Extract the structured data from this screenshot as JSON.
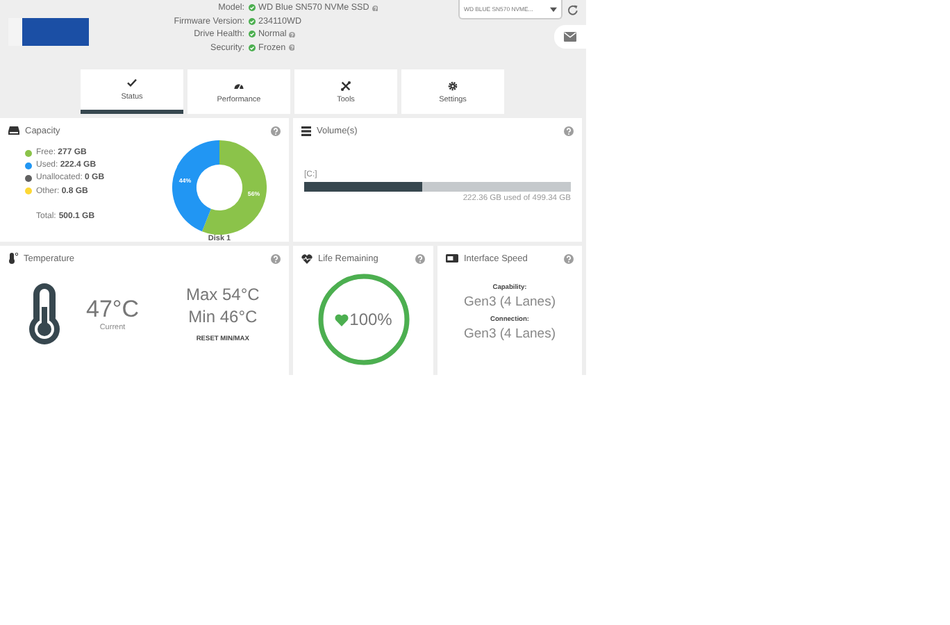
{
  "drive": {
    "model_label": "Model:",
    "model": "WD Blue SN570 NVMe SSD",
    "firmware_label": "Firmware Version:",
    "firmware": "234110WD",
    "health_label": "Drive Health:",
    "health": "Normal",
    "security_label": "Security:",
    "security": "Frozen"
  },
  "drive_select": {
    "value": "WD BLUE SN570 NVME..."
  },
  "tabs": [
    {
      "label": "Status",
      "selected": true
    },
    {
      "label": "Performance",
      "selected": false
    },
    {
      "label": "Tools",
      "selected": false
    },
    {
      "label": "Settings",
      "selected": false
    }
  ],
  "capacity": {
    "title": "Capacity",
    "legend": [
      {
        "label": "Free:",
        "value": "277 GB",
        "color": "#8bc34a"
      },
      {
        "label": "Used:",
        "value": "222.4 GB",
        "color": "#2196f3"
      },
      {
        "label": "Unallocated:",
        "value": "0 GB",
        "color": "#616161"
      },
      {
        "label": "Other:",
        "value": "0.8 GB",
        "color": "#fdd835"
      }
    ],
    "total_label": "Total:",
    "total": "500.1 GB",
    "disk_label": "Disk 1",
    "chart_data": {
      "type": "donut",
      "values": [
        56,
        44
      ],
      "data_labels": true,
      "value_labels": [
        "56%",
        "44%"
      ]
    }
  },
  "volumes": {
    "title": "Volume(s)",
    "items": [
      {
        "name": "[C:]",
        "level": 0.445,
        "reading": "222.36 GB used of 499.34 GB"
      }
    ]
  },
  "temperature": {
    "title": "Temperature",
    "current": "47°C",
    "current_label": "Current",
    "max": "Max 54°C",
    "min": "Min 46°C",
    "reset": "RESET MIN/MAX"
  },
  "life": {
    "title": "Life Remaining",
    "value": "100%",
    "level": 1
  },
  "interface": {
    "title": "Interface Speed",
    "capability_label": "Capability:",
    "capability": "Gen3 (4 Lanes)",
    "connection_label": "Connection:",
    "connection": "Gen3 (4 Lanes)"
  }
}
